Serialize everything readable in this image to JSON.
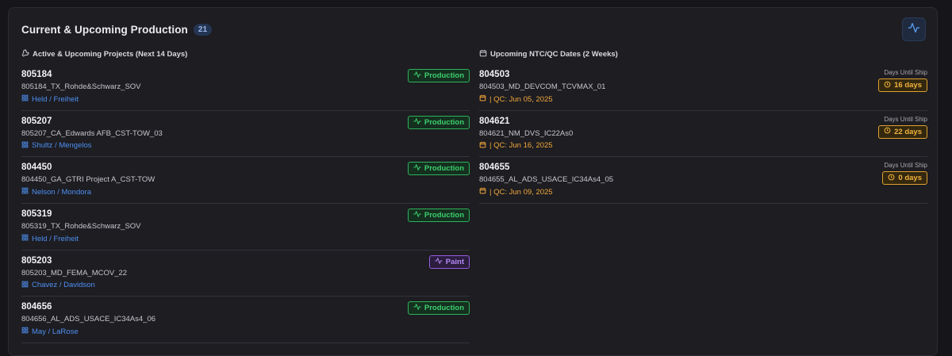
{
  "header": {
    "title": "Current & Upcoming Production",
    "count": "21",
    "action_icon": "activity-icon"
  },
  "colors": {
    "accent_blue": "#4f8ff0",
    "production_green": "#3ccf6e",
    "paint_purple": "#b987f5",
    "qc_orange": "#f2a73a"
  },
  "left": {
    "title": "Active & Upcoming Projects (Next 14 Days)",
    "title_icon": "wrench-icon",
    "projects": [
      {
        "id": "805184",
        "name": "805184_TX_Rohde&Schwarz_SOV",
        "owners": "Held / Freiheit",
        "status": "Production",
        "status_type": "production"
      },
      {
        "id": "805207",
        "name": "805207_CA_Edwards AFB_CST-TOW_03",
        "owners": "Shultz / Mengelos",
        "status": "Production",
        "status_type": "production"
      },
      {
        "id": "804450",
        "name": "804450_GA_GTRI Project A_CST-TOW",
        "owners": "Nelson / Mondora",
        "status": "Production",
        "status_type": "production"
      },
      {
        "id": "805319",
        "name": "805319_TX_Rohde&Schwarz_SOV",
        "owners": "Held / Freiheit",
        "status": "Production",
        "status_type": "production"
      },
      {
        "id": "805203",
        "name": "805203_MD_FEMA_MCOV_22",
        "owners": "Chavez / Davidson",
        "status": "Paint",
        "status_type": "paint"
      },
      {
        "id": "804656",
        "name": "804656_AL_ADS_USACE_IC34As4_06",
        "owners": "May / LaRose",
        "status": "Production",
        "status_type": "production"
      }
    ]
  },
  "right": {
    "title": "Upcoming NTC/QC Dates (2 Weeks)",
    "title_icon": "calendar-icon",
    "days_label": "Days Until Ship",
    "items": [
      {
        "id": "804503",
        "name": "804503_MD_DEVCOM_TCVMAX_01",
        "qc": "| QC: Jun 05, 2025",
        "days": "16 days"
      },
      {
        "id": "804621",
        "name": "804621_NM_DVS_IC22As0",
        "qc": "| QC: Jun 16, 2025",
        "days": "22 days"
      },
      {
        "id": "804655",
        "name": "804655_AL_ADS_USACE_IC34As4_05",
        "qc": "| QC: Jun 09, 2025",
        "days": "0 days"
      }
    ]
  }
}
